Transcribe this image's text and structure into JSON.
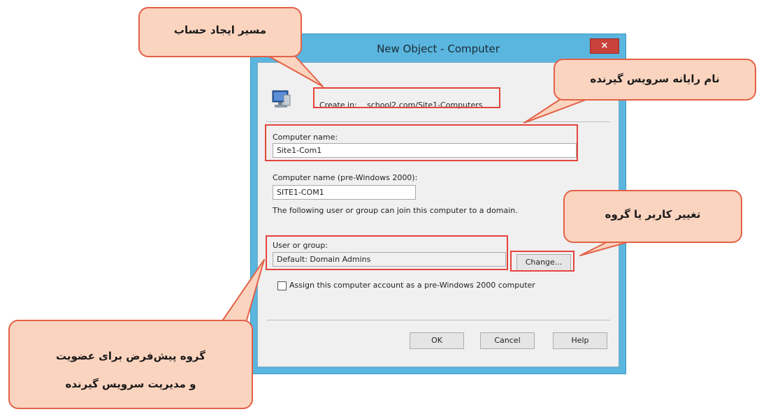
{
  "dialog": {
    "title": "New Object - Computer",
    "close_glyph": "×",
    "create_in_label": "Create in:",
    "create_in_path": "school2.com/Site1-Computers",
    "computer_name_label": "Computer name:",
    "computer_name_value": "Site1-Com1",
    "pre2000_label": "Computer name (pre-Windows 2000):",
    "pre2000_value": "SITE1-COM1",
    "join_info": "The following user or group can join this computer to a domain.",
    "user_group_label": "User or group:",
    "user_group_value": "Default: Domain Admins",
    "change_button": "Change...",
    "assign_checkbox_label": "Assign this computer account as a pre-Windows 2000 computer",
    "assign_checked": false,
    "ok_button": "OK",
    "cancel_button": "Cancel",
    "help_button": "Help",
    "icon": "computer-icon"
  },
  "callouts": {
    "create_path": "مسیر ایجاد حساب",
    "client_name": "نام رایانه سرویس گیرنده",
    "change_user": "تغییر کاربر یا گروه",
    "default_group_line1": "گروه پیش‌فرض برای عضویت",
    "default_group_line2": "و مدیریت سرویس گیرنده"
  },
  "colors": {
    "title_bar": "#5ab6df",
    "close_button": "#c8413a",
    "highlight": "#e4443b",
    "callout_fill": "#fbd4bf",
    "callout_border": "#e36147"
  }
}
